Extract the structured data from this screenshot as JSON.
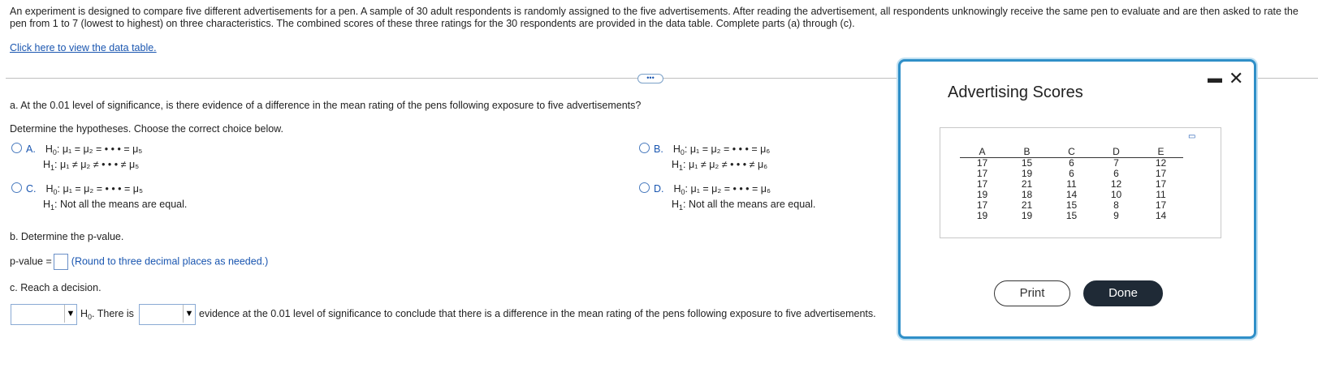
{
  "intro": "An experiment is designed to compare five different advertisements for a pen. A sample of 30 adult respondents is randomly assigned to the five advertisements. After reading the advertisement, all respondents unknowingly receive the same pen to evaluate and are then asked to rate the pen from 1 to 7 (lowest to highest) on three characteristics. The combined scores of these three ratings for the 30 respondents are provided in the data table. Complete parts (a) through (c).",
  "link": "Click here to view the data table.",
  "more_label": "•••",
  "part_a": {
    "question": "a. At the 0.01 level of significance, is there evidence of a difference in the mean rating of the pens following exposure to five advertisements?",
    "prompt": "Determine the hypotheses. Choose the correct choice below.",
    "options": [
      {
        "letter": "A.",
        "h0": "μ₁ = μ₂ = • • • = μ₅",
        "h1": "μ₁ ≠ μ₂ ≠ • • • ≠ μ₅"
      },
      {
        "letter": "B.",
        "h0": "μ₁ = μ₂ = • • • = μ₆",
        "h1": "μ₁ ≠ μ₂ ≠ • • • ≠ μ₆"
      },
      {
        "letter": "C.",
        "h0": "μ₁ = μ₂ = • • • = μ₅",
        "h1": "Not all the means are equal."
      },
      {
        "letter": "D.",
        "h0": "μ₁ = μ₂ = • • • = μ₆",
        "h1": "Not all the means are equal."
      }
    ],
    "h0_label": "H",
    "h0_sub": "0",
    "h1_label": "H",
    "h1_sub": "1"
  },
  "part_b": {
    "question": "b. Determine the p-value.",
    "pvalue_label": "p-value =",
    "hint": "(Round to three decimal places as needed.)"
  },
  "part_c": {
    "question": "c. Reach a decision.",
    "h0_text": ". There is",
    "tail": "evidence at the 0.01 level of significance to conclude that there is a difference in the mean rating of the pens following exposure to five advertisements."
  },
  "modal": {
    "title": "Advertising Scores",
    "headers": [
      "A",
      "B",
      "C",
      "D",
      "E"
    ],
    "rows": [
      [
        "17",
        "15",
        "6",
        "7",
        "12"
      ],
      [
        "17",
        "19",
        "6",
        "6",
        "17"
      ],
      [
        "17",
        "21",
        "11",
        "12",
        "17"
      ],
      [
        "19",
        "18",
        "14",
        "10",
        "11"
      ],
      [
        "17",
        "21",
        "15",
        "8",
        "17"
      ],
      [
        "19",
        "19",
        "15",
        "9",
        "14"
      ]
    ],
    "print_label": "Print",
    "done_label": "Done"
  }
}
